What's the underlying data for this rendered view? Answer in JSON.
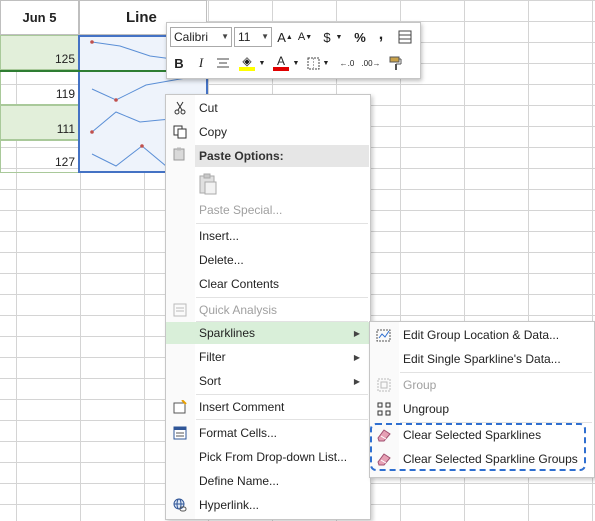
{
  "sheet": {
    "headers": {
      "col_a": "Jun 5",
      "col_b": "Line"
    },
    "values": [
      "125",
      "119",
      "111",
      "127"
    ]
  },
  "mini_toolbar": {
    "font_name": "Calibri",
    "font_size": "11",
    "icons": [
      "increase-font-icon",
      "decrease-font-icon",
      "accounting-format-icon",
      "percent-icon",
      "comma-style-icon",
      "format-painter-table-icon",
      "bold-icon",
      "italic-icon",
      "align-center-icon",
      "fill-color-icon",
      "font-color-icon",
      "borders-icon",
      "increase-decimal-icon",
      "decrease-decimal-icon",
      "format-painter-icon"
    ],
    "bold": "B",
    "italic": "I",
    "dollar": "$",
    "percent": "%",
    "comma": ",",
    "font_color_letter": "A"
  },
  "context_menu": {
    "cut": "Cut",
    "copy": "Copy",
    "paste_options": "Paste Options:",
    "paste_special": "Paste Special...",
    "insert": "Insert...",
    "delete": "Delete...",
    "clear_contents": "Clear Contents",
    "quick_analysis": "Quick Analysis",
    "sparklines": "Sparklines",
    "filter": "Filter",
    "sort": "Sort",
    "insert_comment": "Insert Comment",
    "format_cells": "Format Cells...",
    "pick_dropdown": "Pick From Drop-down List...",
    "define_name": "Define Name...",
    "hyperlink": "Hyperlink..."
  },
  "sparklines_submenu": {
    "edit_group": "Edit Group Location & Data...",
    "edit_single": "Edit Single Sparkline's Data...",
    "group": "Group",
    "ungroup": "Ungroup",
    "clear_selected": "Clear Selected Sparklines",
    "clear_groups": "Clear Selected Sparkline Groups"
  },
  "colors": {
    "accent_green": "#e2efda",
    "selection_blue": "#4472c4",
    "highlight_green": "#d9efd9",
    "dashed_box": "#2f6fd0"
  }
}
